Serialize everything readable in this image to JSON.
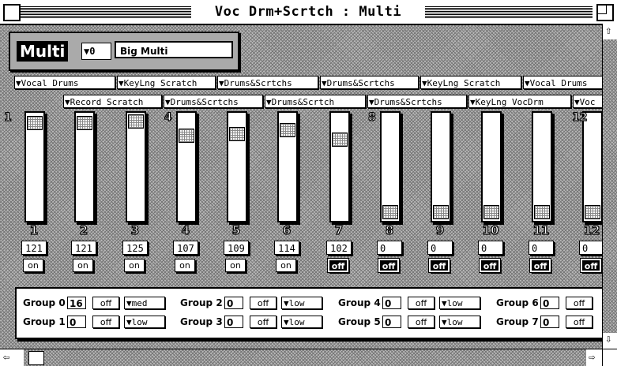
{
  "window": {
    "title": "Voc Drm+Scrtch : Multi"
  },
  "multi": {
    "label": "Multi",
    "preset_number": "0",
    "preset_name": "Big Multi"
  },
  "instruments_row1": [
    "Vocal Drums",
    "KeyLng Scratch",
    "Drums&Scrtchs",
    "Drums&Scrtchs",
    "KeyLng Scratch",
    "Vocal Drums"
  ],
  "instruments_row2": [
    "Record Scratch",
    "Drums&Scrtchs",
    "Drums&Scrtch",
    "Drums&Scrtchs",
    "KeyLng VocDrm",
    "Voc"
  ],
  "top_channel_numbers": [
    "1",
    "4",
    "8",
    "12"
  ],
  "channels": [
    {
      "num": "1",
      "value": "121",
      "state": "on",
      "level": 0.98
    },
    {
      "num": "2",
      "value": "121",
      "state": "on",
      "level": 0.98
    },
    {
      "num": "3",
      "value": "125",
      "state": "on",
      "level": 1.0
    },
    {
      "num": "4",
      "value": "107",
      "state": "on",
      "level": 0.84
    },
    {
      "num": "5",
      "value": "109",
      "state": "on",
      "level": 0.86
    },
    {
      "num": "6",
      "value": "114",
      "state": "on",
      "level": 0.9
    },
    {
      "num": "7",
      "value": "102",
      "state": "off",
      "level": 0.8
    },
    {
      "num": "8",
      "value": "0",
      "state": "off",
      "level": 0.0
    },
    {
      "num": "9",
      "value": "0",
      "state": "off",
      "level": 0.0
    },
    {
      "num": "10",
      "value": "0",
      "state": "off",
      "level": 0.0
    },
    {
      "num": "11",
      "value": "0",
      "state": "off",
      "level": 0.0
    },
    {
      "num": "12",
      "value": "0",
      "state": "off",
      "level": 0.0
    }
  ],
  "groups": [
    {
      "label": "Group 0",
      "value": "16",
      "toggle": "off",
      "mode": "med"
    },
    {
      "label": "Group 2",
      "value": "0",
      "toggle": "off",
      "mode": "low"
    },
    {
      "label": "Group 4",
      "value": "0",
      "toggle": "off",
      "mode": "low"
    },
    {
      "label": "Group 6",
      "value": "0",
      "toggle": "off",
      "mode": ""
    },
    {
      "label": "Group 1",
      "value": "0",
      "toggle": "off",
      "mode": "low"
    },
    {
      "label": "Group 3",
      "value": "0",
      "toggle": "off",
      "mode": "low"
    },
    {
      "label": "Group 5",
      "value": "0",
      "toggle": "off",
      "mode": "low"
    },
    {
      "label": "Group 7",
      "value": "0",
      "toggle": "off",
      "mode": ""
    }
  ],
  "icons": {
    "popup_arrow": "▼",
    "scroll_up": "⇧",
    "scroll_down": "⇩",
    "scroll_left": "⇦",
    "scroll_right": "⇨"
  }
}
